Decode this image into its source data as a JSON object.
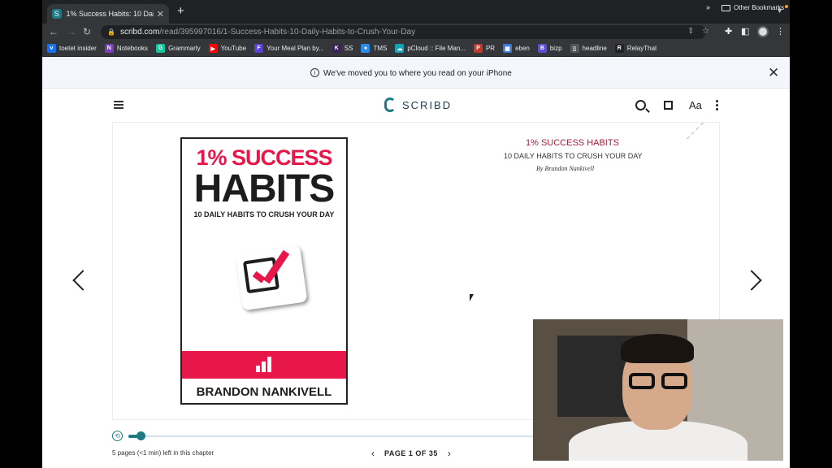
{
  "browser": {
    "tab_title": "1% Success Habits: 10 Daily Ha",
    "tab_favicon": "S",
    "url_host": "scribd.com",
    "url_path": "/read/395997016/1-Success-Habits-10-Daily-Habits-to-Crush-Your-Day",
    "bookmarks": [
      {
        "label": "toetet insider",
        "color": "#1a73e8",
        "glyph": "v"
      },
      {
        "label": "Notebooks",
        "color": "#7b3fb5",
        "glyph": "N"
      },
      {
        "label": "Grammarly",
        "color": "#15c39a",
        "glyph": "G"
      },
      {
        "label": "YouTube",
        "color": "#ff0000",
        "glyph": "▶"
      },
      {
        "label": "Your Meal Plan by...",
        "color": "#5b3fd6",
        "glyph": "F"
      },
      {
        "label": "SS",
        "color": "#3b1f5e",
        "glyph": "K"
      },
      {
        "label": "TMS",
        "color": "#2b8ce6",
        "glyph": "●"
      },
      {
        "label": "pCloud :: File Man...",
        "color": "#17a2b8",
        "glyph": "☁"
      },
      {
        "label": "PR",
        "color": "#c0392b",
        "glyph": "P"
      },
      {
        "label": "eben",
        "color": "#3a7bd5",
        "glyph": "▦"
      },
      {
        "label": "bizp",
        "color": "#5a4fcf",
        "glyph": "B"
      },
      {
        "label": "headline",
        "color": "#555555",
        "glyph": "▯"
      },
      {
        "label": "RelayThat",
        "color": "#222222",
        "glyph": "R"
      }
    ],
    "more_bookmarks": "»",
    "other_bookmarks": "Other Bookmarks"
  },
  "notice": {
    "text": "We've moved you to where you read on your iPhone"
  },
  "reader": {
    "logo_text": "SCRIBD",
    "font_button": "Aa"
  },
  "book": {
    "cover_line1": "1% SUCCESS",
    "cover_line2": "HABITS",
    "cover_line3": "10 DAILY HABITS TO CRUSH YOUR DAY",
    "cover_author": "BRANDON NANKIVELL",
    "title_page_title": "1% SUCCESS HABITS",
    "title_page_subtitle": "10 DAILY HABITS TO CRUSH YOUR DAY",
    "title_page_author": "By Brandon Nankivell"
  },
  "footer": {
    "chapter_remaining": "5 pages (<1 min) left in this chapter",
    "page_label": "PAGE 1 OF 35",
    "progress_fraction": 0.03
  },
  "colors": {
    "accent": "#1e7b85",
    "cover_red": "#e8174a"
  }
}
